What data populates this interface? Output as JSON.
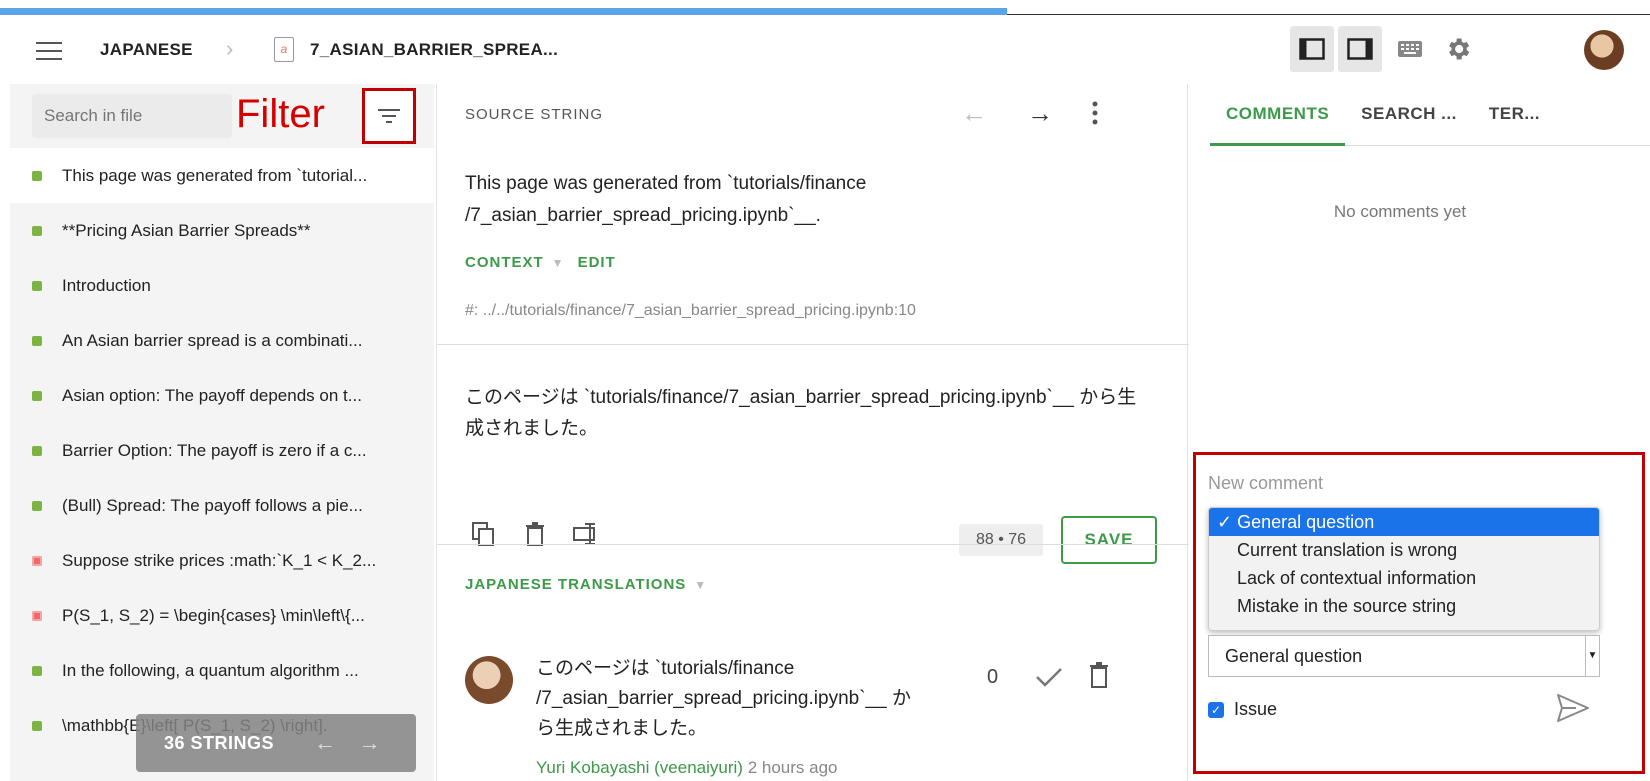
{
  "progress": {
    "percent": 61
  },
  "header": {
    "language": "JAPANESE",
    "file_name": "7_ASIAN_BARRIER_SPREA...",
    "file_icon_letter": "a",
    "icons": [
      "menu-icon",
      "chevron-right-icon",
      "file-icon",
      "left-panel-icon",
      "right-panel-icon",
      "keyboard-icon",
      "gear-icon",
      "avatar"
    ]
  },
  "left": {
    "search_placeholder": "Search in file",
    "filter_annotation": "Filter",
    "strings": [
      {
        "text": "This page was generated from `tutorial...",
        "status": "green"
      },
      {
        "text": "**Pricing Asian Barrier Spreads**",
        "status": "green"
      },
      {
        "text": "Introduction",
        "status": "green"
      },
      {
        "text": "An Asian barrier spread is a combinati...",
        "status": "green"
      },
      {
        "text": "Asian option: The payoff depends on t...",
        "status": "green"
      },
      {
        "text": "Barrier Option: The payoff is zero if a c...",
        "status": "green"
      },
      {
        "text": "(Bull) Spread: The payoff follows a pie...",
        "status": "green"
      },
      {
        "text": "Suppose strike prices :math:`K_1 < K_2...",
        "status": "red"
      },
      {
        "text": "P(S_1, S_2) = \\begin{cases} \\min\\left\\{...",
        "status": "red"
      },
      {
        "text": "In the following, a quantum algorithm ...",
        "status": "green"
      },
      {
        "text": "\\mathbb{E}\\left[ P(S_1, S_2) \\right].",
        "status": "green"
      }
    ],
    "strings_count": "36 STRINGS",
    "colors": {
      "green": "#7cb342",
      "red": "#ef6b6b"
    }
  },
  "middle": {
    "source_label": "SOURCE STRING",
    "source_text": "This page was generated from `tutorials/finance /7_asian_barrier_spread_pricing.ipynb`__.",
    "context_label": "CONTEXT",
    "edit_label": "EDIT",
    "context_path": "#: ../../tutorials/finance/7_asian_barrier_spread_pricing.ipynb:10",
    "translation_text": "このページは `tutorials/finance/7_asian_barrier_spread_pricing.ipynb`__ から生成されました。",
    "counter": "88 • 76",
    "save_label": "SAVE",
    "translations_label": "JAPANESE TRANSLATIONS",
    "suggestion": {
      "text": "このページは `tutorials/finance /7_asian_barrier_spread_pricing.ipynb`__ から生成されました。",
      "votes": "0",
      "author": "Yuri Kobayashi (veenaiyuri)",
      "time": "2 hours ago"
    }
  },
  "right": {
    "tabs": [
      "COMMENTS",
      "SEARCH ...",
      "TER..."
    ],
    "no_comments": "No comments yet",
    "new_comment_placeholder": "New comment",
    "options": [
      "General question",
      "Current translation is wrong",
      "Lack of contextual information",
      "Mistake in the source string"
    ],
    "selected_option": "General question",
    "issue_label": "Issue",
    "check": "✓"
  },
  "accent_color": "#3c9a48"
}
